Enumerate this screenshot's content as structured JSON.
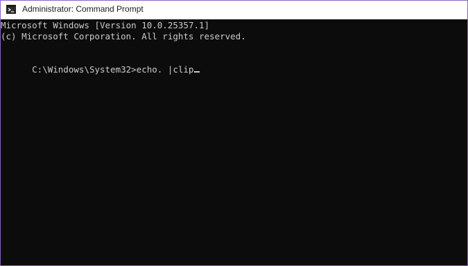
{
  "window": {
    "title": "Administrator: Command Prompt",
    "icon": "command-prompt-icon"
  },
  "terminal": {
    "lines": [
      "Microsoft Windows [Version 10.0.25357.1]",
      "(c) Microsoft Corporation. All rights reserved.",
      "",
      "C:\\Windows\\System32>echo. |clip"
    ]
  },
  "colors": {
    "background": "#0c0c0c",
    "text": "#cccccc",
    "titlebar": "#ffffff",
    "border": "#8a63c4"
  }
}
